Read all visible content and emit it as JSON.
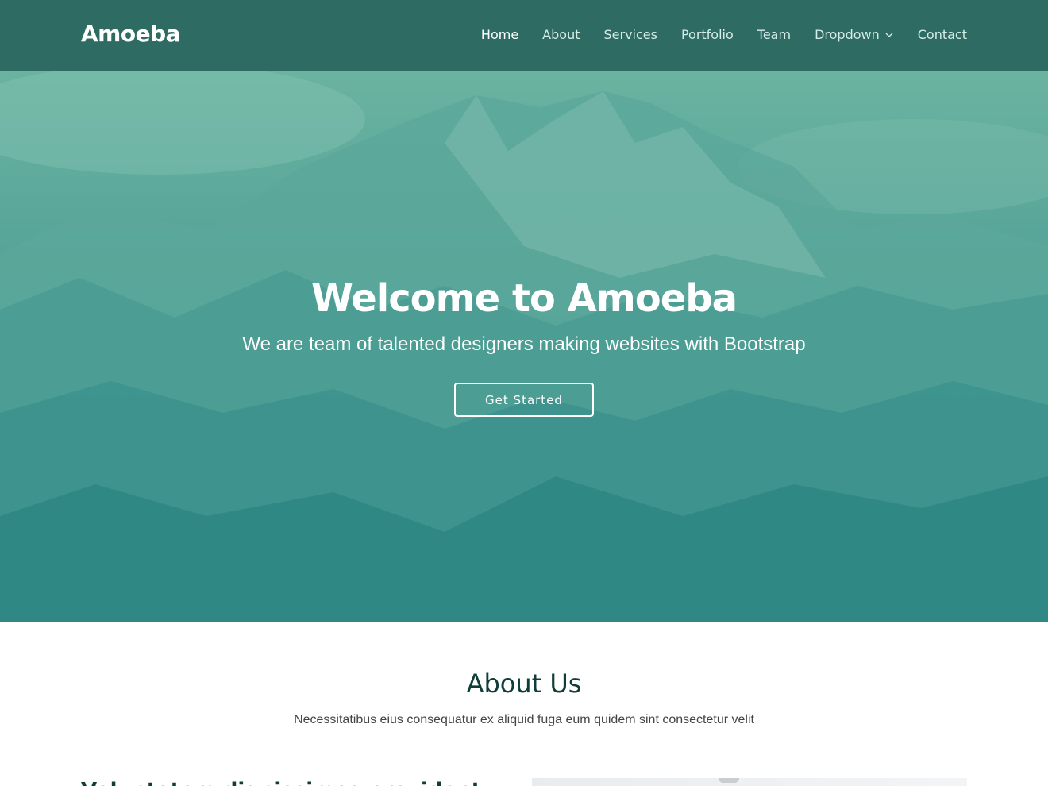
{
  "header": {
    "logo": "Amoeba",
    "nav": [
      {
        "label": "Home",
        "active": true
      },
      {
        "label": "About",
        "active": false
      },
      {
        "label": "Services",
        "active": false
      },
      {
        "label": "Portfolio",
        "active": false
      },
      {
        "label": "Team",
        "active": false
      },
      {
        "label": "Dropdown",
        "active": false,
        "icon": "chevron-down-icon"
      },
      {
        "label": "Contact",
        "active": false
      }
    ]
  },
  "hero": {
    "title": "Welcome to Amoeba",
    "subtitle": "We are team of talented designers making websites with Bootstrap",
    "cta_label": "Get Started"
  },
  "about": {
    "title": "About Us",
    "subtitle": "Necessitatibus eius consequatur ex aliquid fuga eum quidem sint consectetur velit",
    "heading": "Voluptatem dignissimos provident"
  },
  "colors": {
    "header_bg": "#2e6b63",
    "hero_top": "#6bb3a1",
    "hero_bottom": "#2e8784",
    "heading_dark": "#0f3d39"
  }
}
